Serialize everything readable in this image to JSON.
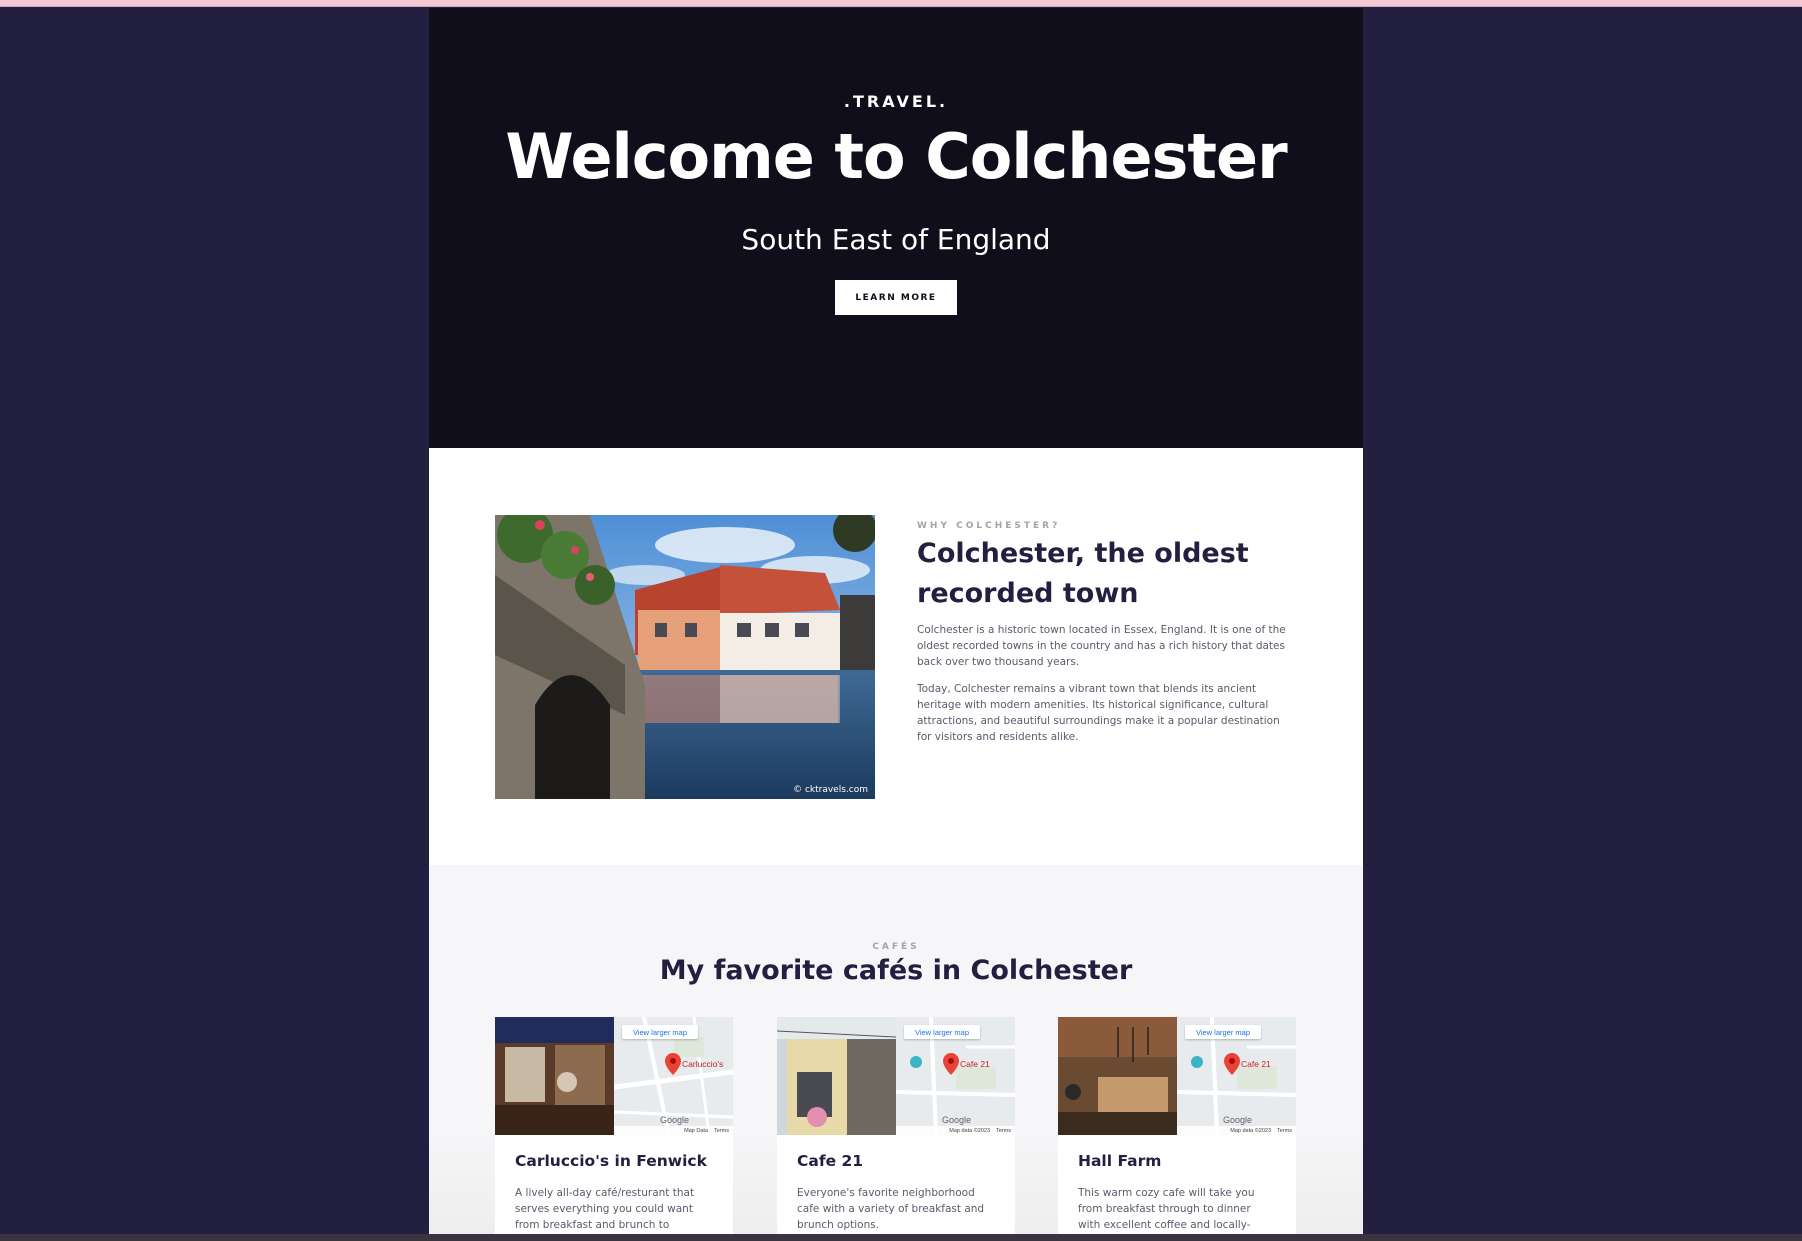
{
  "hero": {
    "eyebrow": ".TRAVEL.",
    "title": "Welcome to Colchester",
    "subtitle": "South East of England",
    "button_label": "LEARN MORE"
  },
  "about": {
    "eyebrow": "WHY COLCHESTER?",
    "heading": "Colchester, the oldest recorded town",
    "paragraphs": [
      "Colchester is a historic town located in Essex, England. It is one of the oldest recorded towns in the country and has a rich history that dates back over two thousand years.",
      "Today, Colchester remains a vibrant town that blends its ancient heritage with modern amenities. Its historical significance, cultural attractions, and beautiful surroundings make it a popular destination for visitors and residents alike."
    ],
    "photo_credit": "© cktravels.com"
  },
  "cafes": {
    "eyebrow": "CAFÉS",
    "heading": "My favorite cafés in Colchester",
    "items": [
      {
        "name": "Carluccio's in Fenwick",
        "description": "A lively all-day café/resturant that serves everything you could want from breakfast and brunch to evening cocktails.",
        "map_link": "View larger map",
        "pin_label": "Carluccio's",
        "map_footer": [
          "Map Data",
          "Terms"
        ],
        "google": "Google"
      },
      {
        "name": "Cafe 21",
        "description": "Everyone's favorite neighborhood cafe with a variety of breakfast and brunch options.",
        "map_link": "View larger map",
        "pin_label": "Cafe 21",
        "map_footer": [
          "Map data ©2023",
          "Terms"
        ],
        "google": "Google"
      },
      {
        "name": "Hall Farm",
        "description": "This warm cozy cafe will take you from breakfast through to dinner with excellent coffee and locally-sourced wines.",
        "map_link": "View larger map",
        "pin_label": "Cafe 21",
        "map_footer": [
          "Map data ©2023",
          "Terms"
        ],
        "google": "Google"
      }
    ]
  },
  "colors": {
    "outer_background": "#231f40",
    "hero_background": "#0f0e1a",
    "heading_text": "#231f40",
    "muted_eyebrow": "#a3a3ae",
    "map_link": "#1a73e8",
    "map_pin": "#ea4335"
  }
}
